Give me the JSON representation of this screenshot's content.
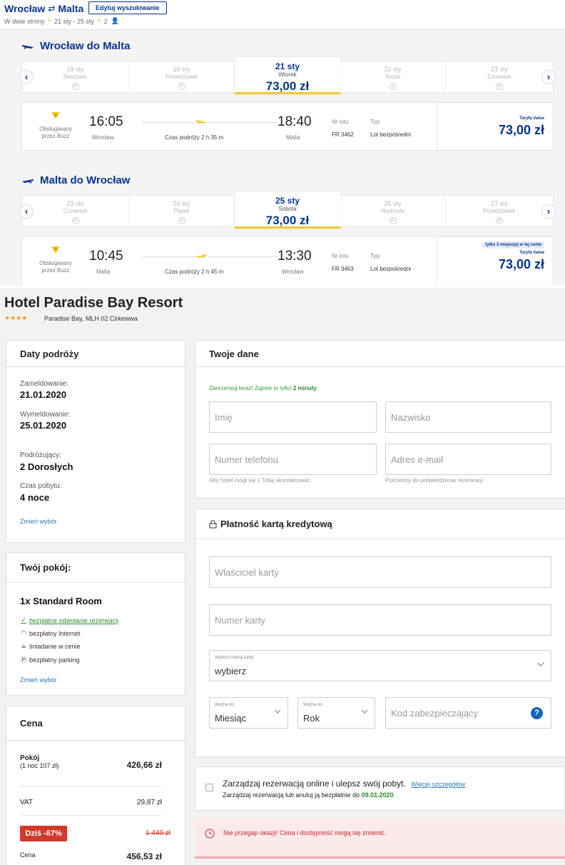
{
  "trip": {
    "route_from": "Wrocław",
    "route_to": "Malta",
    "edit_label": "Edytuj wyszukiwanie",
    "sub_type": "W dwie strony",
    "sub_dates": "21 sty - 25 sty",
    "sub_pax": "2"
  },
  "outbound": {
    "title": "Wrocław do Malta",
    "dates": [
      {
        "d": "19 sty",
        "w": "Niedziela"
      },
      {
        "d": "20 sty",
        "w": "Poniedziałek"
      },
      {
        "d": "22 sty",
        "w": "Środa"
      },
      {
        "d": "23 sty",
        "w": "Czwartek"
      }
    ],
    "selected": {
      "d": "21 sty",
      "w": "Wtorek",
      "price": "73,00 zł"
    },
    "flight": {
      "operated_by": "Obsługiwany przez Buzz",
      "dep_time": "16:05",
      "dep_city": "Wrocław",
      "duration": "Czas podróży 2 h 35 m",
      "arr_time": "18:40",
      "arr_city": "Malta",
      "flight_no_label": "Nr lotu",
      "flight_no": "FR 3462",
      "type_label": "Typ",
      "type": "Lot bezpośredni",
      "fare_label": "Taryfa Value",
      "fare": "73,00 zł"
    }
  },
  "inbound": {
    "title": "Malta do Wrocław",
    "dates": [
      {
        "d": "23 sty",
        "w": "Czwartek"
      },
      {
        "d": "24 sty",
        "w": "Piątek"
      },
      {
        "d": "26 sty",
        "w": "Niedziela"
      },
      {
        "d": "27 sty",
        "w": "Poniedziałek"
      }
    ],
    "selected": {
      "d": "25 sty",
      "w": "Sobota",
      "price": "73,00 zł"
    },
    "flight": {
      "operated_by": "Obsługiwany przez Buzz",
      "dep_time": "10:45",
      "dep_city": "Malta",
      "duration": "Czas podróży 2 h 45 m",
      "arr_time": "13:30",
      "arr_city": "Wrocław",
      "flight_no_label": "Nr lotu",
      "flight_no": "FR 3463",
      "type_label": "Typ",
      "type": "Lot bezpośredni",
      "badge": "tylko 2 miejsc(a) w tej cenie",
      "fare_label": "Taryfa Value",
      "fare": "73,00 zł"
    }
  },
  "hotel": {
    "name": "Hotel Paradise Bay Resort",
    "stars": "★★★★",
    "address": "Paradise Bay, MLH 02 Cirkewwa"
  },
  "travel_dates": {
    "title": "Daty podróży",
    "checkin_label": "Zameldowanie:",
    "checkin": "21.01.2020",
    "checkout_label": "Wymeldowanie:",
    "checkout": "25.01.2020",
    "travellers_label": "Podróżujący:",
    "travellers": "2 Dorosłych",
    "stay_label": "Czas pobytu:",
    "stay": "4 noce",
    "change": "Zmień wybór"
  },
  "room": {
    "title": "Twój pokój:",
    "name": "1x Standard Room",
    "features": [
      "bezpłatne odwołanie rezerwacji",
      "bezpłatny Internet",
      "śniadanie w cenie",
      "bezpłatny parking"
    ],
    "change": "Zmień wybór"
  },
  "price": {
    "title": "Cena",
    "room_label": "Pokój",
    "room_sub": "(1 noc 107 zł)",
    "room_amount": "426,66 zł",
    "vat_label": "VAT",
    "vat_amount": "29,87 zł",
    "discount": "Dziś -67%",
    "old_price": "1 449 zł",
    "total_label": "Cena",
    "total": "456,53 zł"
  },
  "your_data": {
    "title": "Twoje dane",
    "note_pre": "Zarezerwuj teraz! Zajmie to tylko ",
    "note_bold": "2 minuty",
    "note_post": ".",
    "first_name_ph": "Imię",
    "last_name_ph": "Nazwisko",
    "phone_ph": "Numer telefonu",
    "email_ph": "Adres e-mail",
    "phone_hint": "Aby hotel mógł się z Tobą skontaktować.",
    "email_hint": "Potrzebny do potwierdzenia rezerwacji"
  },
  "payment": {
    "title": "Płatność kartą kredytową",
    "holder_ph": "Właściciel karty",
    "number_ph": "Numer karty",
    "card_type_caption": "Wybierz rodzaj karty",
    "card_type_value": "wybierz",
    "month_caption": "Ważna do",
    "month_value": "Miesiąc",
    "year_caption": "Ważna do",
    "year_value": "Rok",
    "cvc_ph": "Kod zabezpieczający",
    "help": "?"
  },
  "manage": {
    "title": "Zarządzaj rezerwacją online i ulepsz swój pobyt.",
    "more": "Więcej szczegółów",
    "sub": "Zarządzaj rezerwacją lub anuluj ją bezpłatnie do ",
    "date": "09.01.2020"
  },
  "warning": {
    "text": "Nie przegap okazji! Cena i dostępność mogą się zmienić."
  },
  "colors": {
    "brand": "#073590",
    "accent": "#f1c933",
    "discount": "#d03a2a",
    "success": "#2e8b2e",
    "warning_bg": "#fce9ea"
  }
}
